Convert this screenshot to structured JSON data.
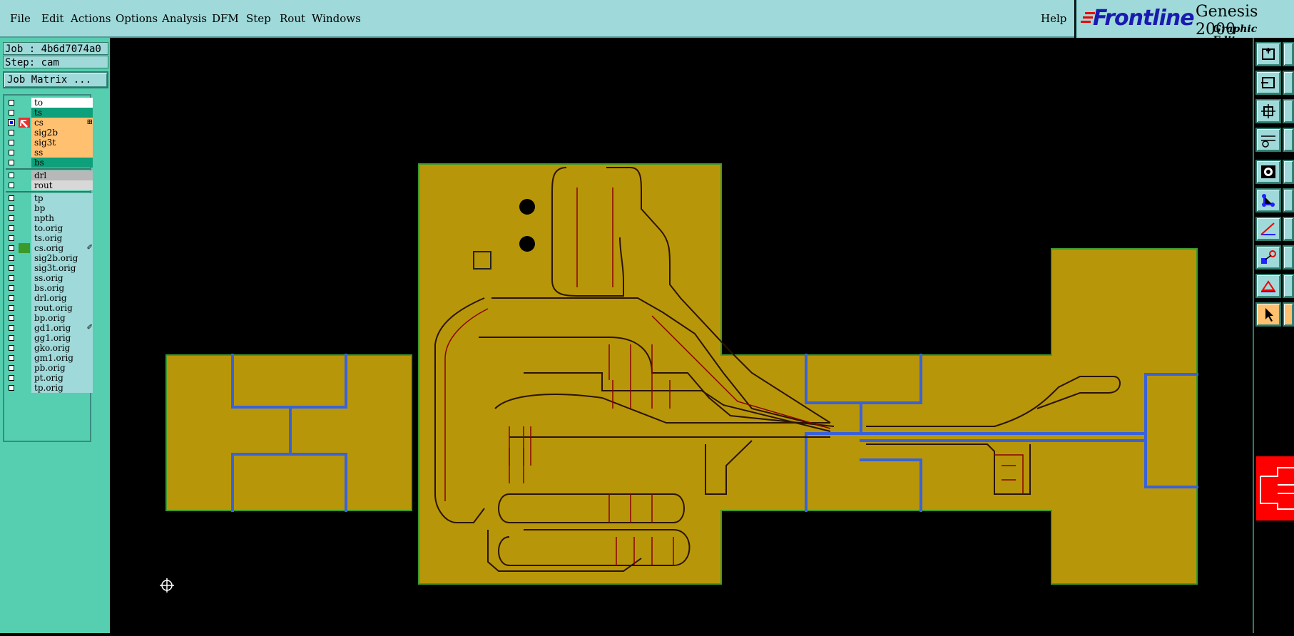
{
  "menu": {
    "items": [
      "File",
      "Edit",
      "Actions",
      "Options",
      "Analysis",
      "DFM",
      "Step",
      "Rout",
      "Windows"
    ],
    "help": "Help"
  },
  "branding": {
    "company": "Frontline",
    "product": "Genesis 2000",
    "subtitle": "Graphic Editor",
    "logo_color": "#1a1ab0"
  },
  "job": {
    "job_label": "Job : 4b6d7074a0",
    "step_label": "Step: cam",
    "matrix_button": "Job Matrix ..."
  },
  "layers": {
    "board": [
      {
        "name": "to",
        "color": "#ffffff",
        "checked": false
      },
      {
        "name": "ts",
        "color": "#0ea07a",
        "checked": false
      },
      {
        "name": "cs",
        "color": "#ffc070",
        "checked": true,
        "work": true,
        "mark": "⊞"
      },
      {
        "name": "sig2b",
        "color": "#ffc070",
        "checked": false
      },
      {
        "name": "sig3t",
        "color": "#ffc070",
        "checked": false
      },
      {
        "name": "ss",
        "color": "#ffc070",
        "checked": false
      },
      {
        "name": "bs",
        "color": "#0ea07a",
        "checked": false
      }
    ],
    "drill": [
      {
        "name": "drl",
        "color": "#b8b8b8",
        "checked": false
      },
      {
        "name": "rout",
        "color": "#d8d8d8",
        "checked": false
      }
    ],
    "misc": [
      {
        "name": "tp",
        "checked": false
      },
      {
        "name": "bp",
        "checked": false
      },
      {
        "name": "npth",
        "checked": false
      },
      {
        "name": "to.orig",
        "checked": false
      },
      {
        "name": "ts.orig",
        "checked": false
      },
      {
        "name": "cs.orig",
        "checked": false,
        "swatch": "#3c9a2a",
        "mark": "✐"
      },
      {
        "name": "sig2b.orig",
        "checked": false
      },
      {
        "name": "sig3t.orig",
        "checked": false
      },
      {
        "name": "ss.orig",
        "checked": false
      },
      {
        "name": "bs.orig",
        "checked": false
      },
      {
        "name": "drl.orig",
        "checked": false
      },
      {
        "name": "rout.orig",
        "checked": false
      },
      {
        "name": "bp.orig",
        "checked": false
      },
      {
        "name": "gd1.orig",
        "checked": false,
        "mark": "✐"
      },
      {
        "name": "gg1.orig",
        "checked": false
      },
      {
        "name": "gko.orig",
        "checked": false
      },
      {
        "name": "gm1.orig",
        "checked": false
      },
      {
        "name": "pb.orig",
        "checked": false
      },
      {
        "name": "pt.orig",
        "checked": false
      },
      {
        "name": "tp.orig",
        "checked": false
      }
    ],
    "misc_color": "#9fd9d9"
  },
  "colors": {
    "copper": "#b8960a",
    "trace_edge": "#8a0000",
    "blue_trace": "#3a62d8",
    "panel_bg": "#55cfb0",
    "menu_bg": "#9fd9d9"
  },
  "toolbar": {
    "icons": [
      "zoom-home-icon",
      "zoom-previous-icon",
      "zoom-fit-icon",
      "snap-settings-icon",
      "measure-icon",
      "connect-icon",
      "angle-icon",
      "move-icon",
      "triangle-icon",
      "select-pointer-icon"
    ]
  }
}
